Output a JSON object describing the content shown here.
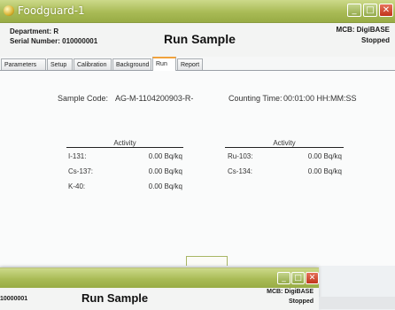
{
  "window": {
    "title": "Foodguard-1",
    "controls": {
      "minimize": "_",
      "maximize": "□",
      "close": "✕"
    }
  },
  "header": {
    "department": "Department: R",
    "serial": "Serial Number: 010000001",
    "title": "Run Sample",
    "mcb": "MCB: DigiBASE",
    "status": "Stopped"
  },
  "tabs": [
    {
      "label": "Parameters"
    },
    {
      "label": "Setup"
    },
    {
      "label": "Calibration"
    },
    {
      "label": "Background"
    },
    {
      "label": "Run",
      "active": true
    },
    {
      "label": "Report"
    }
  ],
  "run": {
    "sample_code_label": "Sample Code:",
    "sample_code_value": "AG-M-1104200903-R-",
    "counting_time_label": "Counting Time:",
    "counting_time_value": "00:01:00 HH:MM:SS",
    "activity_left": {
      "header": "Activity",
      "rows": [
        {
          "nuclide": "I-131:",
          "value": "0.00 Bq/kq"
        },
        {
          "nuclide": "Cs-137:",
          "value": "0.00 Bq/kq"
        },
        {
          "nuclide": "K-40:",
          "value": "0.00 Bq/kq"
        }
      ]
    },
    "activity_right": {
      "header": "Activity",
      "rows": [
        {
          "nuclide": "Ru-103:",
          "value": "0.00 Bq/kq"
        },
        {
          "nuclide": "Cs-134:",
          "value": "0.00 Bq/kq"
        }
      ]
    }
  },
  "window2": {
    "serial_fragment": "10000001",
    "title": "Run Sample",
    "mcb": "MCB: DigiBASE",
    "status": "Stopped",
    "controls": {
      "minimize": "_",
      "maximize": "□",
      "close": "✕"
    }
  },
  "colors": {
    "titlebar": "#a9bb56",
    "active_tab_accent": "#f1a23c",
    "close_button": "#c0341b"
  }
}
